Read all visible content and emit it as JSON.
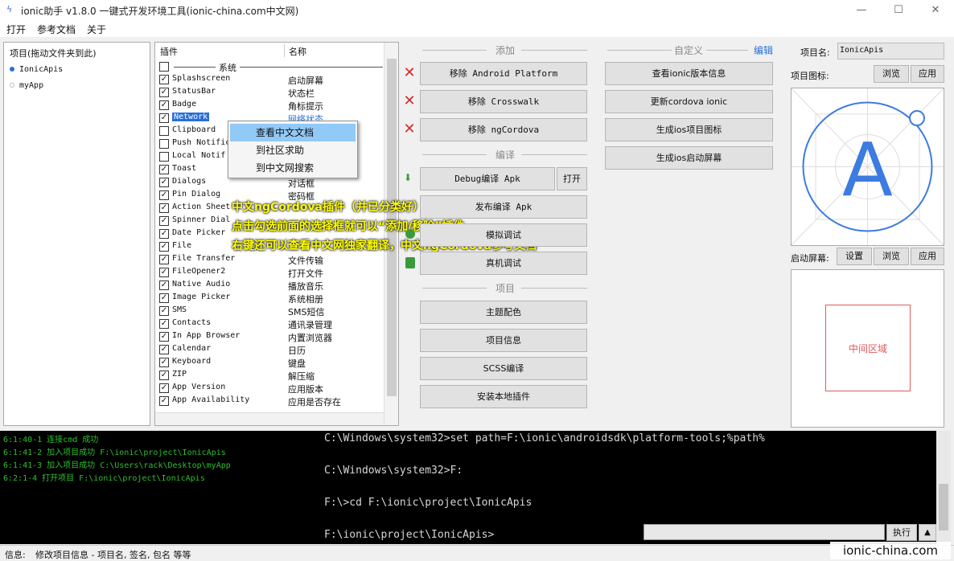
{
  "window": {
    "title": "ionic助手 v1.8.0 一键式开发环境工具(ionic-china.com中文网)",
    "minimize": "—",
    "maximize": "☐",
    "close": "✕"
  },
  "menu": [
    "打开",
    "参考文档",
    "关于"
  ],
  "projects": {
    "header": "项目(拖动文件夹到此)",
    "items": [
      {
        "name": "IonicApis",
        "active": true
      },
      {
        "name": "myApp",
        "active": false
      }
    ]
  },
  "plugins": {
    "col_plugin": "插件",
    "col_name": "名称",
    "group": "系统",
    "rows": [
      {
        "name": "Splashscreen",
        "cn": "启动屏幕",
        "checked": true
      },
      {
        "name": "StatusBar",
        "cn": "状态栏",
        "checked": true
      },
      {
        "name": "Badge",
        "cn": "角标提示",
        "checked": true
      },
      {
        "name": "Network",
        "cn": "网络状态",
        "checked": true,
        "selected": true
      },
      {
        "name": "Clipboard",
        "cn": "",
        "checked": false
      },
      {
        "name": "Push Notific",
        "cn": "",
        "checked": false
      },
      {
        "name": "Local Notif",
        "cn": "",
        "checked": false
      },
      {
        "name": "Toast",
        "cn": "",
        "checked": true
      },
      {
        "name": "Dialogs",
        "cn": "对话框",
        "checked": true
      },
      {
        "name": "Pin Dialog",
        "cn": "密码框",
        "checked": true
      },
      {
        "name": "Action Sheet",
        "cn": "",
        "checked": true
      },
      {
        "name": "Spinner Dial",
        "cn": "",
        "checked": true
      },
      {
        "name": "Date Picker",
        "cn": "",
        "checked": true
      },
      {
        "name": "File",
        "cn": "",
        "checked": true
      },
      {
        "name": "File Transfer",
        "cn": "文件传输",
        "checked": true
      },
      {
        "name": "FileOpener2",
        "cn": "打开文件",
        "checked": true
      },
      {
        "name": "Native Audio",
        "cn": "播放音乐",
        "checked": true
      },
      {
        "name": "Image Picker",
        "cn": "系统相册",
        "checked": true
      },
      {
        "name": "SMS",
        "cn": "SMS短信",
        "checked": true
      },
      {
        "name": "Contacts",
        "cn": "通讯录管理",
        "checked": true
      },
      {
        "name": "In App Browser",
        "cn": "内置浏览器",
        "checked": true
      },
      {
        "name": "Calendar",
        "cn": "日历",
        "checked": true
      },
      {
        "name": "Keyboard",
        "cn": "键盘",
        "checked": true
      },
      {
        "name": "ZIP",
        "cn": "解压缩",
        "checked": true
      },
      {
        "name": "App Version",
        "cn": "应用版本",
        "checked": true
      },
      {
        "name": "App Availability",
        "cn": "应用是否存在",
        "checked": true
      }
    ]
  },
  "context_menu": [
    "查看中文文档",
    "到社区求助",
    "到中文网搜索"
  ],
  "annotation": [
    "中文ngCordova插件（并已分类好）",
    "点击勾选前面的选择框就可以“添加/移除”插件",
    "右键还可以查看中文网独家翻译，中文ngCordova参考文档"
  ],
  "sections": {
    "add": "添加",
    "compile": "编译",
    "project": "项目",
    "custom": "自定义",
    "edit": "编辑"
  },
  "buttons": {
    "remove_android": "移除 Android Platform",
    "remove_crosswalk": "移除 Crosswalk",
    "remove_ngcordova": "移除 ngCordova",
    "debug_apk": "Debug编译 Apk",
    "open": "打开",
    "release_apk": "发布编译 Apk",
    "run": "模拟调试",
    "device": "真机调试",
    "theme": "主题配色",
    "project_info": "项目信息",
    "scss": "SCSS编译",
    "install_plugin": "安装本地插件",
    "view_ionic": "查看ionic版本信息",
    "update_cordova": "更新cordova ionic",
    "gen_icon": "生成ios项目图标",
    "gen_splash": "生成ios启动屏幕",
    "browse": "浏览",
    "apply": "应用",
    "setup": "设置",
    "execute": "执行",
    "up": "▲"
  },
  "right": {
    "project_name_label": "项目名:",
    "project_name_value": "IonicApis",
    "icon_label": "项目图标:",
    "icon_letter": "A",
    "splash_label": "启动屏幕:",
    "splash_center": "中间区域"
  },
  "log": [
    "6:1:40-1 连接cmd 成功",
    "6:1:41-2 加入项目成功 F:\\ionic\\project\\IonicApis",
    "6:1:41-3 加入项目成功 C:\\Users\\rack\\Desktop\\myApp",
    "6:2:1-4 打开项目 F:\\ionic\\project\\IonicApis"
  ],
  "terminal": [
    "C:\\Windows\\system32>set path=F:\\ionic\\androidsdk\\platform-tools;%path%",
    "C:\\Windows\\system32>F:",
    "F:\\>cd F:\\ionic\\project\\IonicApis",
    "F:\\ionic\\project\\IonicApis>"
  ],
  "status": {
    "label": "信息:",
    "text": "修改项目信息 - 项目名, 签名, 包名 等等"
  },
  "watermark": "ionic-china.com",
  "colors": {
    "accent": "#2a6fd6",
    "remove_x": "#d42a2a",
    "log_text": "#2fbf2f",
    "annotation": "#ffff00",
    "icon_ring": "#3c7be0",
    "splash_box": "#e05a5a"
  }
}
